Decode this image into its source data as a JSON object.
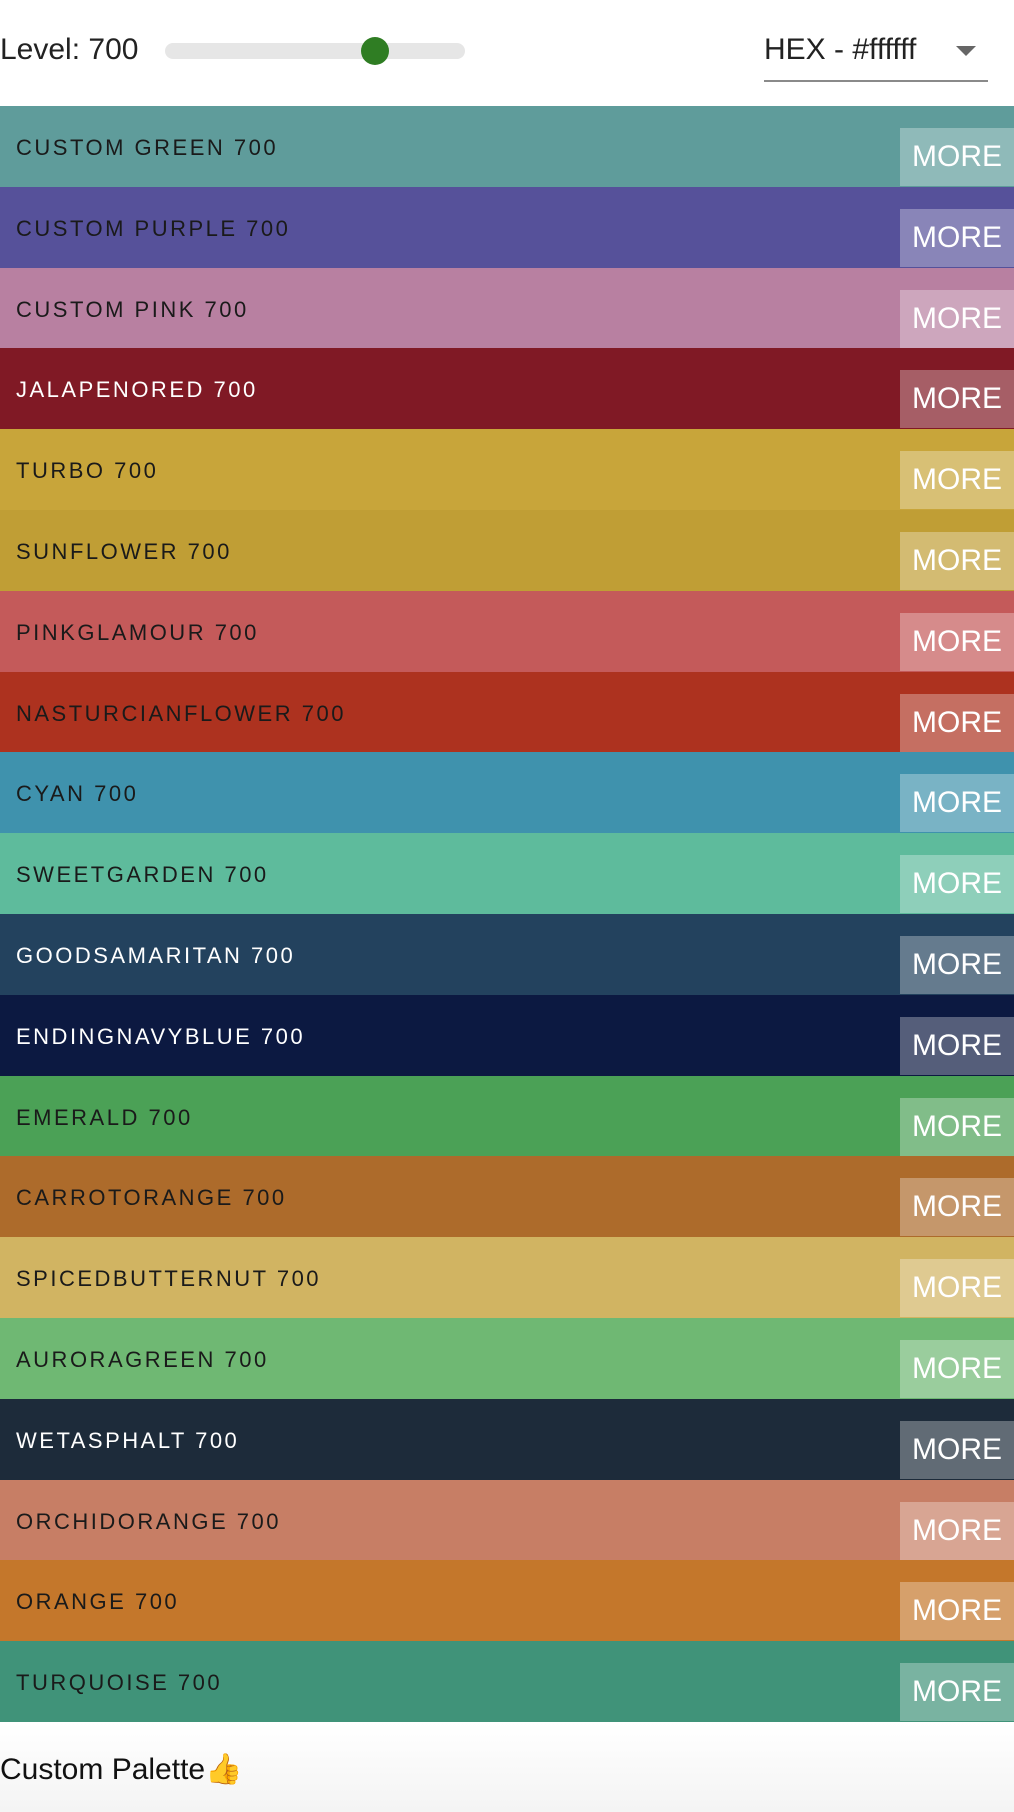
{
  "navbar": {
    "level_label": "Level: 700",
    "level_value": 700,
    "level_min": 100,
    "level_max": 900,
    "slider_thumb_fraction": 0.7,
    "format_select": "HEX - #ffffff"
  },
  "palette": {
    "more_label": "MORE",
    "colors": [
      {
        "name": "CUSTOM GREEN 700",
        "color": "#5f9c9b",
        "text_color": "#1a1a1a"
      },
      {
        "name": "CUSTOM PURPLE 700",
        "color": "#56519a",
        "text_color": "#1a1a1a"
      },
      {
        "name": "CUSTOM PINK 700",
        "color": "#b880a1",
        "text_color": "#1a1a1a"
      },
      {
        "name": "JALAPENORED 700",
        "color": "#801925",
        "text_color": "#ffffff"
      },
      {
        "name": "TURBO 700",
        "color": "#c8a53a",
        "text_color": "#1a1a1a"
      },
      {
        "name": "SUNFLOWER 700",
        "color": "#c09e35",
        "text_color": "#1a1a1a"
      },
      {
        "name": "PINKGLAMOUR 700",
        "color": "#c45a5a",
        "text_color": "#1a1a1a"
      },
      {
        "name": "NASTURCIANFLOWER 700",
        "color": "#ad321f",
        "text_color": "#1a1a1a"
      },
      {
        "name": "CYAN 700",
        "color": "#3f92ad",
        "text_color": "#1a1a1a"
      },
      {
        "name": "SWEETGARDEN 700",
        "color": "#5ebb9c",
        "text_color": "#1a1a1a"
      },
      {
        "name": "GOODSAMARITAN 700",
        "color": "#23425e",
        "text_color": "#ffffff"
      },
      {
        "name": "ENDINGNAVYBLUE 700",
        "color": "#0c1941",
        "text_color": "#ffffff"
      },
      {
        "name": "EMERALD 700",
        "color": "#4ba156",
        "text_color": "#1a1a1a"
      },
      {
        "name": "CARROTORANGE 700",
        "color": "#ad6b2b",
        "text_color": "#1a1a1a"
      },
      {
        "name": "SPICEDBUTTERNUT 700",
        "color": "#d1b462",
        "text_color": "#1a1a1a"
      },
      {
        "name": "AURORAGREEN 700",
        "color": "#6fb873",
        "text_color": "#1a1a1a"
      },
      {
        "name": "WETASPHALT 700",
        "color": "#1d2b3a",
        "text_color": "#ffffff"
      },
      {
        "name": "ORCHIDORANGE 700",
        "color": "#c77e65",
        "text_color": "#1a1a1a"
      },
      {
        "name": "ORANGE 700",
        "color": "#c4772b",
        "text_color": "#1a1a1a"
      },
      {
        "name": "TURQUOISE 700",
        "color": "#409379",
        "text_color": "#1a1a1a"
      }
    ]
  },
  "footer": {
    "palette_name": "Custom Palette👍"
  }
}
